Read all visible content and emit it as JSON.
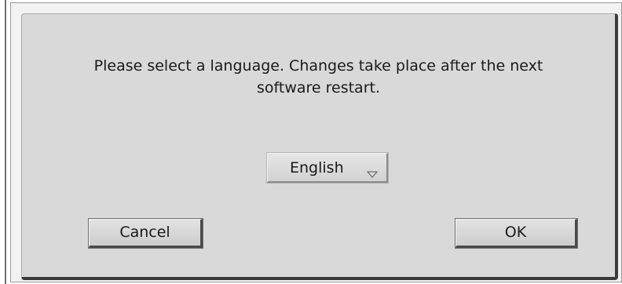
{
  "dialog": {
    "message_line1": "Please select a language. Changes take place after the next",
    "message_line2": "software restart.",
    "language_select": {
      "selected": "English",
      "icon": "chevron-down-icon"
    },
    "buttons": {
      "cancel_label": "Cancel",
      "ok_label": "OK"
    }
  }
}
